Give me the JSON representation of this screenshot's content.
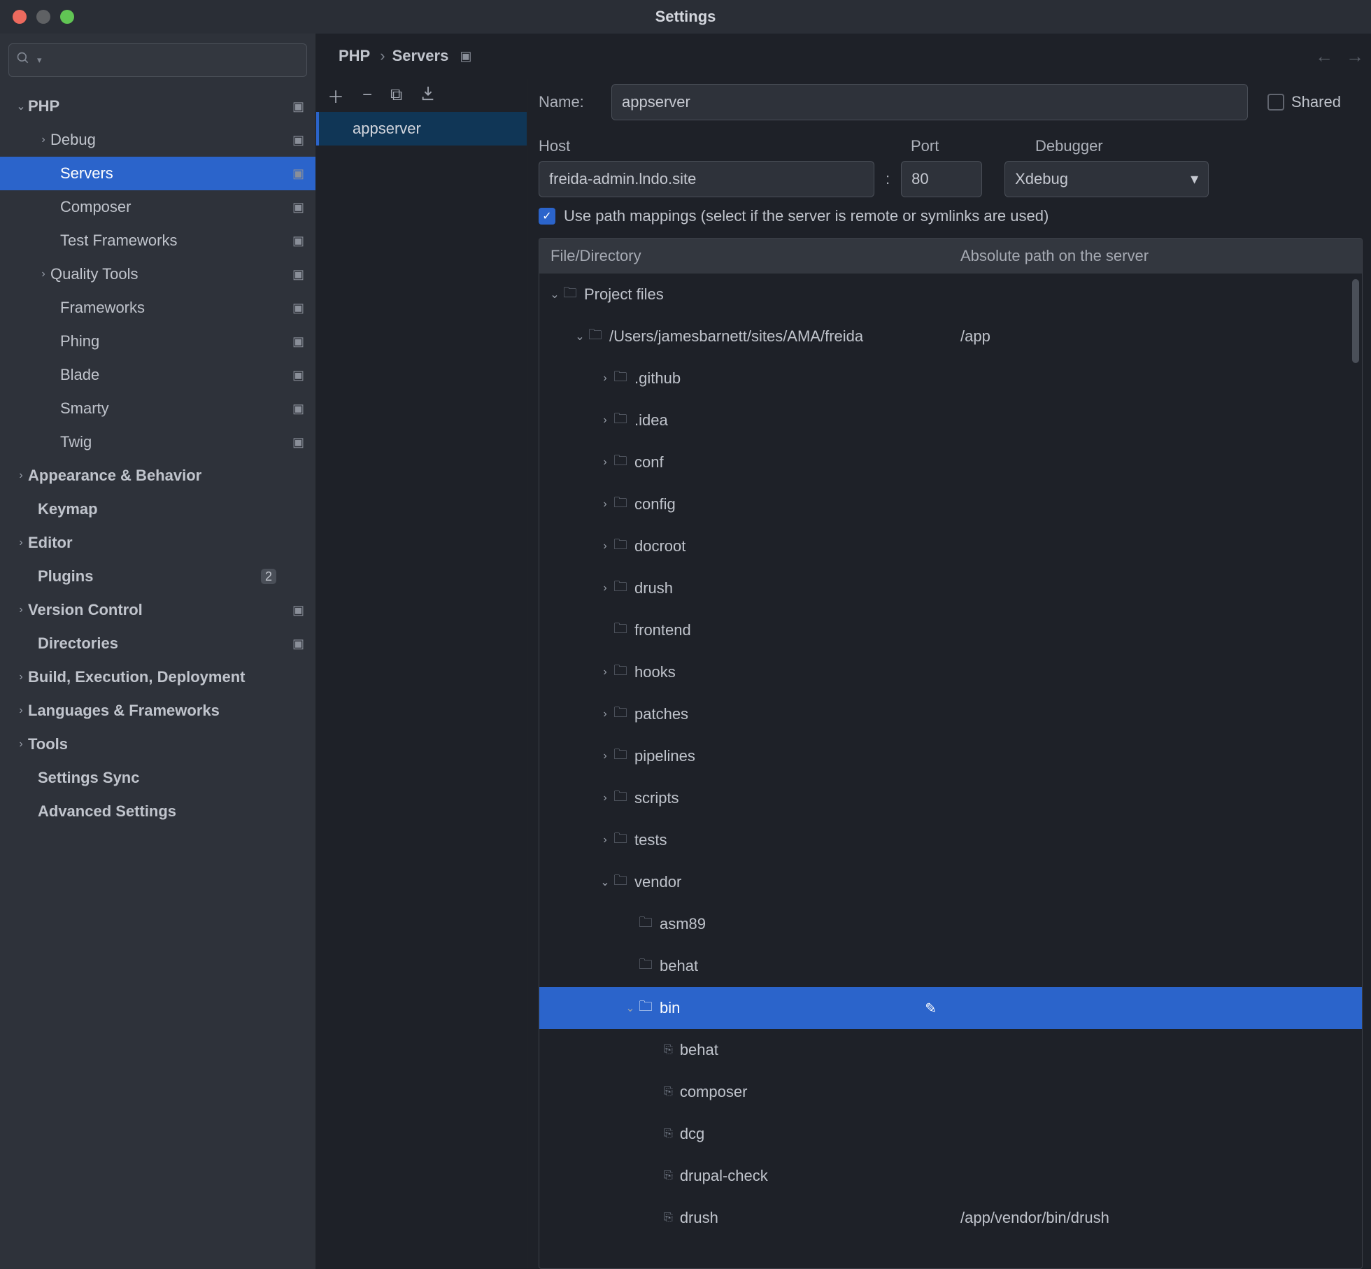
{
  "window": {
    "title": "Settings"
  },
  "sidebar": {
    "search_placeholder": "",
    "groups": {
      "php": {
        "label": "PHP"
      },
      "debug": {
        "label": "Debug"
      },
      "servers": {
        "label": "Servers"
      },
      "composer": {
        "label": "Composer"
      },
      "test_frameworks": {
        "label": "Test Frameworks"
      },
      "quality_tools": {
        "label": "Quality Tools"
      },
      "frameworks": {
        "label": "Frameworks"
      },
      "phing": {
        "label": "Phing"
      },
      "blade": {
        "label": "Blade"
      },
      "smarty": {
        "label": "Smarty"
      },
      "twig": {
        "label": "Twig"
      },
      "appearance": {
        "label": "Appearance & Behavior"
      },
      "keymap": {
        "label": "Keymap"
      },
      "editor": {
        "label": "Editor"
      },
      "plugins": {
        "label": "Plugins",
        "badge": "2"
      },
      "version_control": {
        "label": "Version Control"
      },
      "directories": {
        "label": "Directories"
      },
      "bed": {
        "label": "Build, Execution, Deployment"
      },
      "lang_fw": {
        "label": "Languages & Frameworks"
      },
      "tools": {
        "label": "Tools"
      },
      "settings_sync": {
        "label": "Settings Sync"
      },
      "advanced": {
        "label": "Advanced Settings"
      }
    }
  },
  "breadcrumb": {
    "a": "PHP",
    "b": "Servers"
  },
  "server_list": {
    "items": {
      "0": "appserver"
    }
  },
  "form": {
    "name_label": "Name:",
    "name_value": "appserver",
    "shared_label": "Shared",
    "host_label": "Host",
    "host_value": "freida-admin.lndo.site",
    "port_label": "Port",
    "port_value": "80",
    "debugger_label": "Debugger",
    "debugger_value": "Xdebug",
    "path_mappings_label": "Use path mappings (select if the server is remote or symlinks are used)"
  },
  "map": {
    "header": {
      "col1": "File/Directory",
      "col2": "Absolute path on the server"
    },
    "root": {
      "label": "Project files"
    },
    "proj": {
      "label": "/Users/jamesbarnett/sites/AMA/freida",
      "abs": "/app"
    },
    "folders": {
      "github": ".github",
      "idea": ".idea",
      "conf": "conf",
      "config": "config",
      "docroot": "docroot",
      "drush": "drush",
      "frontend": "frontend",
      "hooks": "hooks",
      "patches": "patches",
      "pipelines": "pipelines",
      "scripts": "scripts",
      "tests": "tests",
      "vendor": "vendor",
      "asm89": "asm89",
      "behatf": "behat",
      "bin": "bin",
      "behat": "behat",
      "composer": "composer",
      "dcg": "dcg",
      "drupal_check": "drupal-check",
      "drush2": "drush",
      "drush2_abs": "/app/vendor/bin/drush"
    }
  }
}
